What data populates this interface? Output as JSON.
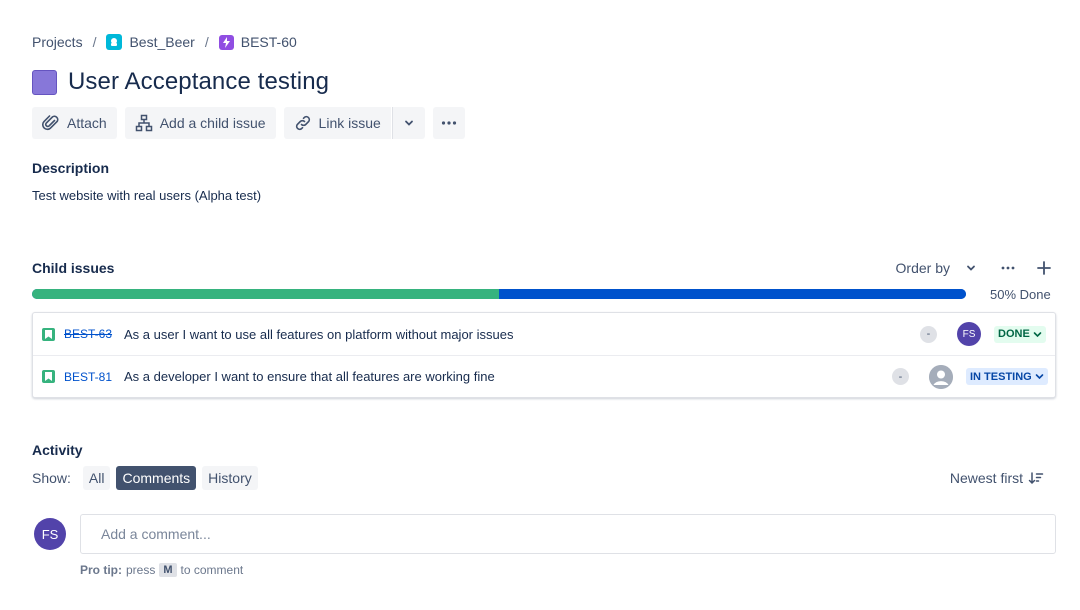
{
  "breadcrumb": {
    "projects": "Projects",
    "project": "Best_Beer",
    "epic_key": "BEST-60",
    "separator": "/"
  },
  "issue": {
    "title": "User Acceptance testing"
  },
  "toolbar": {
    "attach": "Attach",
    "add_child": "Add a child issue",
    "link_issue": "Link issue"
  },
  "description": {
    "label": "Description",
    "text": "Test website with real users (Alpha test)"
  },
  "child_issues": {
    "label": "Child issues",
    "order_by": "Order by",
    "progress_fraction": 0.5,
    "progress_label": "50% Done",
    "items": [
      {
        "key": "BEST-63",
        "summary": "As a user I want to use all features on platform without major issues",
        "priority": "-",
        "assignee": "FS",
        "status": "DONE"
      },
      {
        "key": "BEST-81",
        "summary": "As a developer I want to ensure that all features are working fine",
        "priority": "-",
        "assignee": "",
        "status": "IN TESTING"
      }
    ]
  },
  "activity": {
    "label": "Activity",
    "show_label": "Show:",
    "filters": [
      "All",
      "Comments",
      "History"
    ],
    "active_filter": "Comments",
    "sort": "Newest first"
  },
  "comment": {
    "avatar": "FS",
    "placeholder": "Add a comment...",
    "protip_strong": "Pro tip:",
    "protip_press": "press",
    "protip_key": "M",
    "protip_rest": "to comment"
  },
  "colors": {
    "done_green": "#36b37e",
    "progress_blue": "#0052cc",
    "epic_purple": "#904ee2",
    "avatar_purple": "#5243aa"
  }
}
